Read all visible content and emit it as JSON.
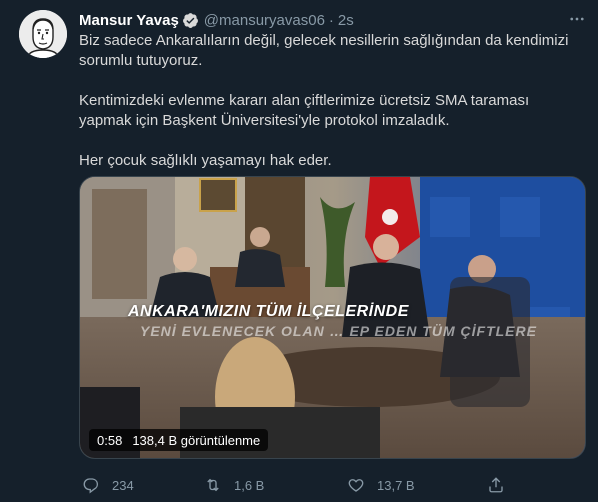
{
  "tweet": {
    "author_name": "Mansur Yavaş",
    "handle": "@mansuryavas06",
    "separator": "·",
    "time": "2s",
    "verified": true,
    "paragraphs": [
      "Biz sadece Ankaralıların değil, gelecek nesillerin sağlığından da kendimizi sorumlu tutuyoruz.",
      "Kentimizdeki evlenme kararı alan çiftlerimize ücretsiz SMA taraması yapmak için Başkent Üniversitesi'yle protokol imzaladık.",
      "Her çocuk sağlıklı yaşamayı hak eder."
    ]
  },
  "media": {
    "type": "video",
    "overlay_line1": "ANKARA'MIZIN TÜM İLÇELERİNDE",
    "overlay_line2": "YENİ EVLENECEK OLAN … EP EDEN TÜM ÇİFTLERE",
    "duration": "0:58",
    "views": "138,4 B görüntülenme"
  },
  "actions": {
    "replies": "234",
    "retweets": "1,6 B",
    "likes": "13,7 B"
  },
  "icons": [
    "avatar",
    "verified-badge-icon",
    "more-icon",
    "reply-icon",
    "retweet-icon",
    "like-icon",
    "share-icon"
  ],
  "colors": {
    "background": "#15202b",
    "text": "#d9d9d9",
    "secondary": "#8899a6",
    "verified": "#1da1f2"
  }
}
